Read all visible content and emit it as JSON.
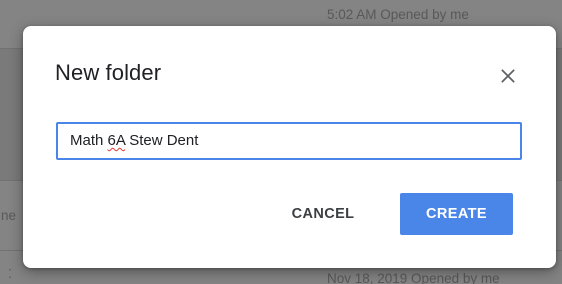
{
  "background": {
    "top_row_text": "5:02 AM  Opened by me",
    "mid_row_edge_text": "ne",
    "bottom_row_text": "Nov 18, 2019  Opened by me",
    "bottom_row_edge_text": "⁚"
  },
  "dialog": {
    "title": "New folder",
    "close_icon": "close-icon",
    "input": {
      "value": "Math 6A Stew Dent",
      "value_prefix": "Math ",
      "misspelled_word": "6A",
      "value_suffix": " Stew Dent"
    },
    "cancel_label": "CANCEL",
    "create_label": "CREATE"
  },
  "colors": {
    "accent": "#4a86e8",
    "title_text": "#202124",
    "button_text": "#3c4043",
    "spellcheck_underline": "#e53935"
  }
}
